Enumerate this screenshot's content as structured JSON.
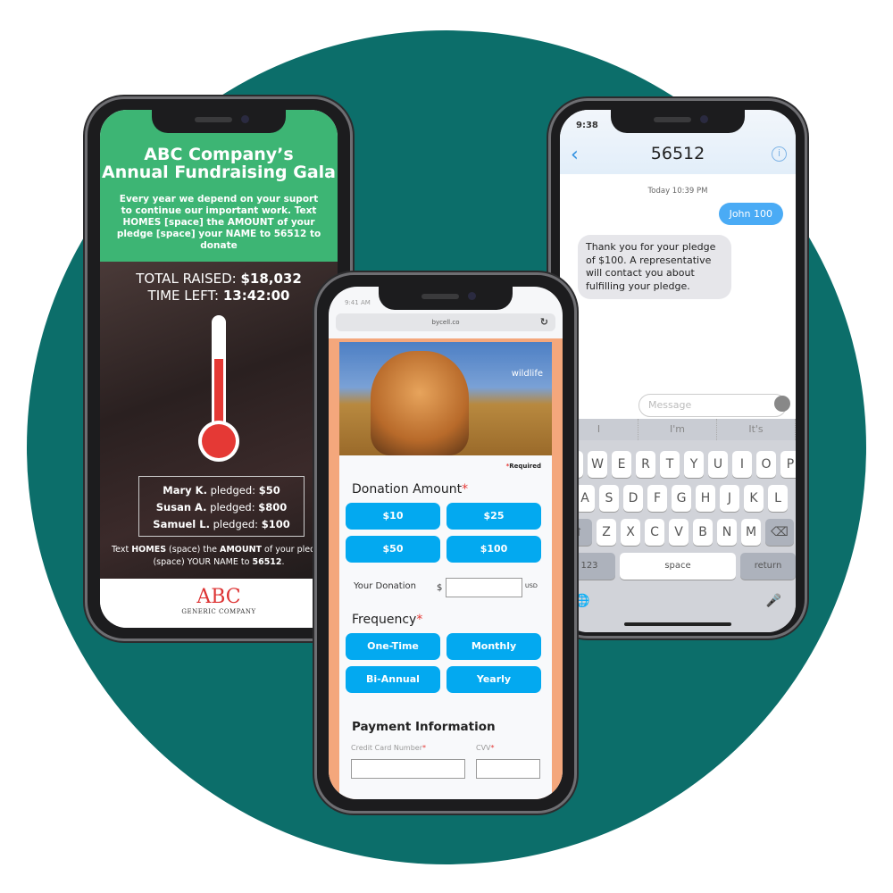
{
  "colors": {
    "background_circle": "#0c6e6a",
    "green_header": "#3db574",
    "button_blue": "#03a9f0",
    "orange_border": "#f4a77c",
    "sent_bubble": "#4aabf5",
    "thermometer": "#e53935"
  },
  "left_phone": {
    "title_line1": "ABC Company’s",
    "title_line2": "Annual Fundraising Gala",
    "intro": "Every year we depend on your suport to continue our important work. Text HOMES [space] the AMOUNT  of your pledge [space] your NAME to 56512 to donate",
    "total_label": "TOTAL RAISED: ",
    "total_value": "$18,032",
    "time_label": "TIME LEFT: ",
    "time_value": "13:42:00",
    "thermometer_level_percent": 65,
    "pledges": [
      {
        "name": "Mary K.",
        "mid": " pledged: ",
        "amount": "$50"
      },
      {
        "name": "Susan A.",
        "mid": " pledged: ",
        "amount": "$800"
      },
      {
        "name": "Samuel L.",
        "mid": " pledged: ",
        "amount": "$100"
      }
    ],
    "instructions": {
      "p1": "Text ",
      "b1": "HOMES",
      "p2": " (space) the ",
      "b2": "AMOUNT",
      "p3": " of your pledge (space) YOUR NAME to ",
      "b3": "56512",
      "p4": "."
    },
    "logo_text": "ABC",
    "logo_sub": "GENERIC COMPANY"
  },
  "middle_phone": {
    "time": "9:41 AM",
    "url": "bycell.co",
    "reload_icon": "↻",
    "brand": "wildlife",
    "required": "Required",
    "donation_heading": "Donation Amount",
    "amounts": [
      "$10",
      "$25",
      "$50",
      "$100"
    ],
    "your_donation_label": "Your Donation",
    "currency_symbol": "$",
    "currency": "USD",
    "donation_value": "",
    "frequency_heading": "Frequency",
    "frequencies": [
      "One-Time",
      "Monthly",
      "Bi-Annual",
      "Yearly"
    ],
    "payment_heading": "Payment Information",
    "card_label": "Credit Card Number",
    "cvv_label": "CVV",
    "star": "*"
  },
  "right_phone": {
    "time": "9:38",
    "contact": "56512",
    "back_icon": "‹",
    "info_icon": "i",
    "timestamp": "Today 10:39 PM",
    "sent": "John 100",
    "received": "Thank you for your pledge of $100. A representative will contact you about fulfilling your pledge.",
    "message_placeholder": "Message",
    "suggestions": [
      "I",
      "I'm",
      "It's"
    ],
    "keys_row1": [
      "Q",
      "W",
      "E",
      "R",
      "T",
      "Y",
      "U",
      "I",
      "O",
      "P"
    ],
    "keys_row2": [
      "A",
      "S",
      "D",
      "F",
      "G",
      "H",
      "J",
      "K",
      "L"
    ],
    "keys_row3": [
      "Z",
      "X",
      "C",
      "V",
      "B",
      "N",
      "M"
    ],
    "shift_icon": "⇧",
    "delete_icon": "⌫",
    "numbers_key": "123",
    "space_key": "space",
    "return_key": "return",
    "globe_icon": "🌐",
    "mic_icon": "🎤"
  }
}
